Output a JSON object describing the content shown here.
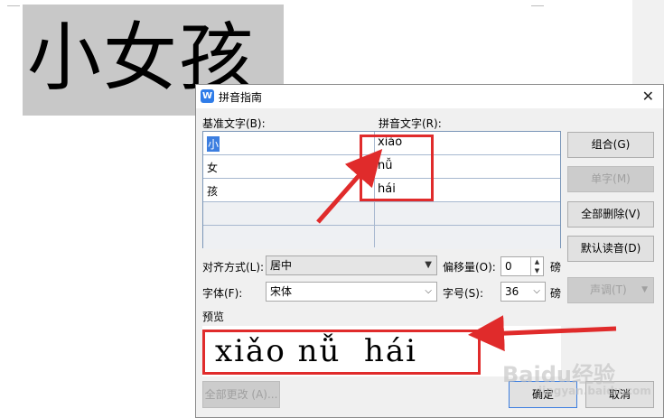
{
  "document": {
    "text": "小女孩"
  },
  "dialog": {
    "title": "拼音指南",
    "app_icon": "wps-icon",
    "base_text_label": "基准文字(B):",
    "pinyin_text_label": "拼音文字(R):",
    "rows": [
      {
        "base": "小",
        "pinyin": "xiǎo"
      },
      {
        "base": "女",
        "pinyin": "nǚ"
      },
      {
        "base": "孩",
        "pinyin": "hái"
      },
      {
        "base": "",
        "pinyin": ""
      },
      {
        "base": "",
        "pinyin": ""
      }
    ],
    "buttons": {
      "combine": "组合(G)",
      "single": "单字(M)",
      "delete_all": "全部删除(V)",
      "default_reading": "默认读音(D)",
      "tone": "声调(T)",
      "change_all": "全部更改 (A)...",
      "ok": "确定",
      "cancel": "取消"
    },
    "align_label": "对齐方式(L):",
    "align_value": "居中",
    "offset_label": "偏移量(O):",
    "offset_value": "0",
    "offset_unit": "磅",
    "font_label": "字体(F):",
    "font_value": "宋体",
    "size_label": "字号(S):",
    "size_value": "36",
    "size_unit": "磅",
    "preview_label": "预览",
    "preview_text": "xiǎo nǚ  hái"
  },
  "watermark": {
    "text": "Baidu经验",
    "sub": "jingyan.baidu.com"
  },
  "colors": {
    "annotation": "#e02b2b",
    "selection": "#3c7ee0"
  }
}
